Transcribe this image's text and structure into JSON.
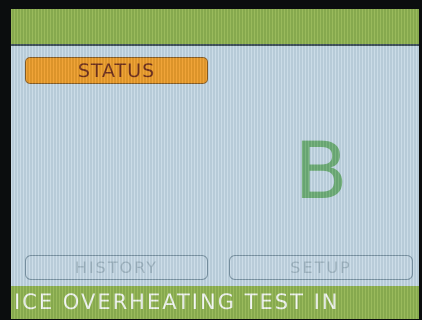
{
  "status_button": {
    "label": "STATUS"
  },
  "main": {
    "letter": "B"
  },
  "bottom_buttons": {
    "history_label": "HISTORY",
    "setup_label": "SETUP"
  },
  "ticker": {
    "text": "ICE OVERHEATING TEST IN"
  },
  "colors": {
    "header_green": "#8fb24a",
    "status_orange": "#ee9a22",
    "letter_green": "#6cac72",
    "screen_background": "#c5d8e4"
  }
}
